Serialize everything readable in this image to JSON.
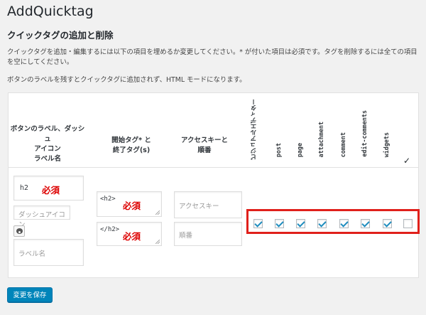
{
  "page": {
    "title": "AddQuicktag",
    "section_title": "クイックタグの追加と削除",
    "description_1": "クイックタグを追加・編集するには以下の項目を埋めるか変更してください。* が付いた項目は必須です。タグを削除するには全ての項目を空にしてください。",
    "description_2": "ボタンのラベルを残すとクイックタグに追加されず、HTML モードになります。"
  },
  "table": {
    "headers": {
      "label_col": "ボタンのラベル、ダッシュアイコン\nラベル名",
      "tag_col": "開始タグ* と\n終了タグ(s)",
      "access_col": "アクセスキーと\n順番",
      "visual_editor": "ビジュアルエディター",
      "post_types": [
        "post",
        "page",
        "attachment",
        "comment",
        "edit-comments",
        "widgets"
      ],
      "all_check": "✓"
    },
    "row": {
      "button_label_value": "h2",
      "button_label_required": "必須",
      "dashicon_placeholder": "ダッシュアイコン",
      "label_name_placeholder": "ラベル名",
      "start_tag_value": "<h2>",
      "start_tag_required": "必須",
      "end_tag_value": "</h2>",
      "end_tag_required": "必須",
      "access_key_placeholder": "アクセスキー",
      "order_placeholder": "順番",
      "checkboxes": {
        "visual_editor": true,
        "post": true,
        "page": true,
        "attachment": true,
        "comment": true,
        "edit-comments": true,
        "widgets": true,
        "all": false
      }
    }
  },
  "actions": {
    "save_label": "変更を保存"
  },
  "colors": {
    "accent": "#0085ba",
    "required": "#dd0000",
    "highlight": "#e0201b",
    "background": "#f1f1f1"
  }
}
